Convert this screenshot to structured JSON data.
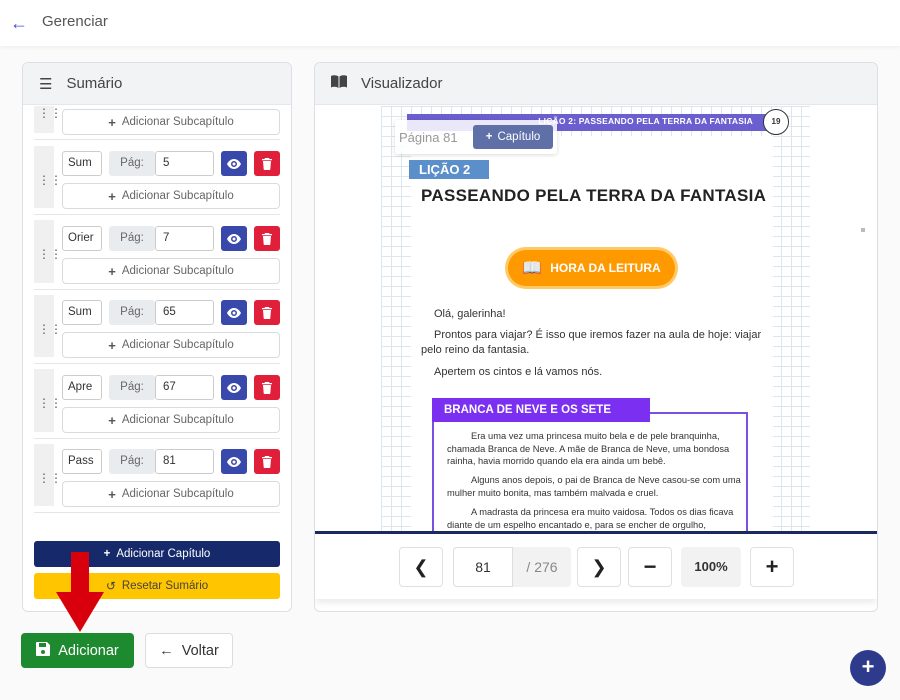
{
  "header": {
    "title": "Gerenciar"
  },
  "toc": {
    "title": "Sumário",
    "add_sub_label": "Adicionar Subcapítulo",
    "pag_label": "Pág:",
    "entries": [
      {
        "name": "Sum",
        "page": "5"
      },
      {
        "name": "Orier",
        "page": "7"
      },
      {
        "name": "Sum",
        "page": "65"
      },
      {
        "name": "Apre",
        "page": "67"
      },
      {
        "name": "Pass",
        "page": "81"
      }
    ],
    "add_chapter_label": "Adicionar Capítulo",
    "reset_label": "Resetar Sumário"
  },
  "viewer": {
    "title": "Visualizador",
    "page_overlay_label": "Página 81",
    "chapter_btn_label": "Capítulo",
    "book": {
      "header_text": "LIÇÃO 2: PASSEANDO PELA TERRA DA FANTASIA",
      "page_number": "19",
      "lesson_tag": "LIÇÃO 2",
      "lesson_title": "PASSEANDO PELA TERRA DA FANTASIA",
      "hora_label": "HORA DA LEITURA",
      "p1": "Olá, galerinha!",
      "p2": "Prontos para viajar? É isso que iremos fazer na aula de hoje: viajar pelo reino da fantasia.",
      "p3": "Apertem os cintos e lá vamos nós.",
      "story_title": "BRANCA DE NEVE E OS SETE ANÕES",
      "story_p1": "Era uma vez uma princesa muito bela e de pele branquinha, chamada Branca de Neve. A mãe de Branca de Neve, uma bondosa rainha, havia morrido quando ela era ainda um bebê.",
      "story_p2": "Alguns anos depois, o pai de Branca de Neve casou-se com uma mulher muito bonita, mas também malvada e cruel.",
      "story_p3": "A madrasta da princesa era muito vaidosa. Todos os dias ficava diante de um espelho encantado e, para se encher de orgulho,"
    },
    "footer": {
      "current_page": "81",
      "total_pages": "/ 276",
      "zoom": "100%"
    }
  },
  "actions": {
    "save_label": "Adicionar",
    "back_label": "Voltar"
  },
  "icons": {
    "back": "arrow-left-icon",
    "list": "list-icon",
    "book": "book-open-icon",
    "eye": "eye-icon",
    "trash": "trash-icon",
    "grip": "drag-handle-icon",
    "save": "floppy-disk-icon",
    "reset": "undo-icon",
    "fab": "plus-icon"
  },
  "colors": {
    "primary": "#3949ab",
    "danger": "#e0203a",
    "navy": "#15296b",
    "warning": "#ffc600",
    "success": "#1e8a30",
    "annotation_arrow": "#d9000d"
  }
}
